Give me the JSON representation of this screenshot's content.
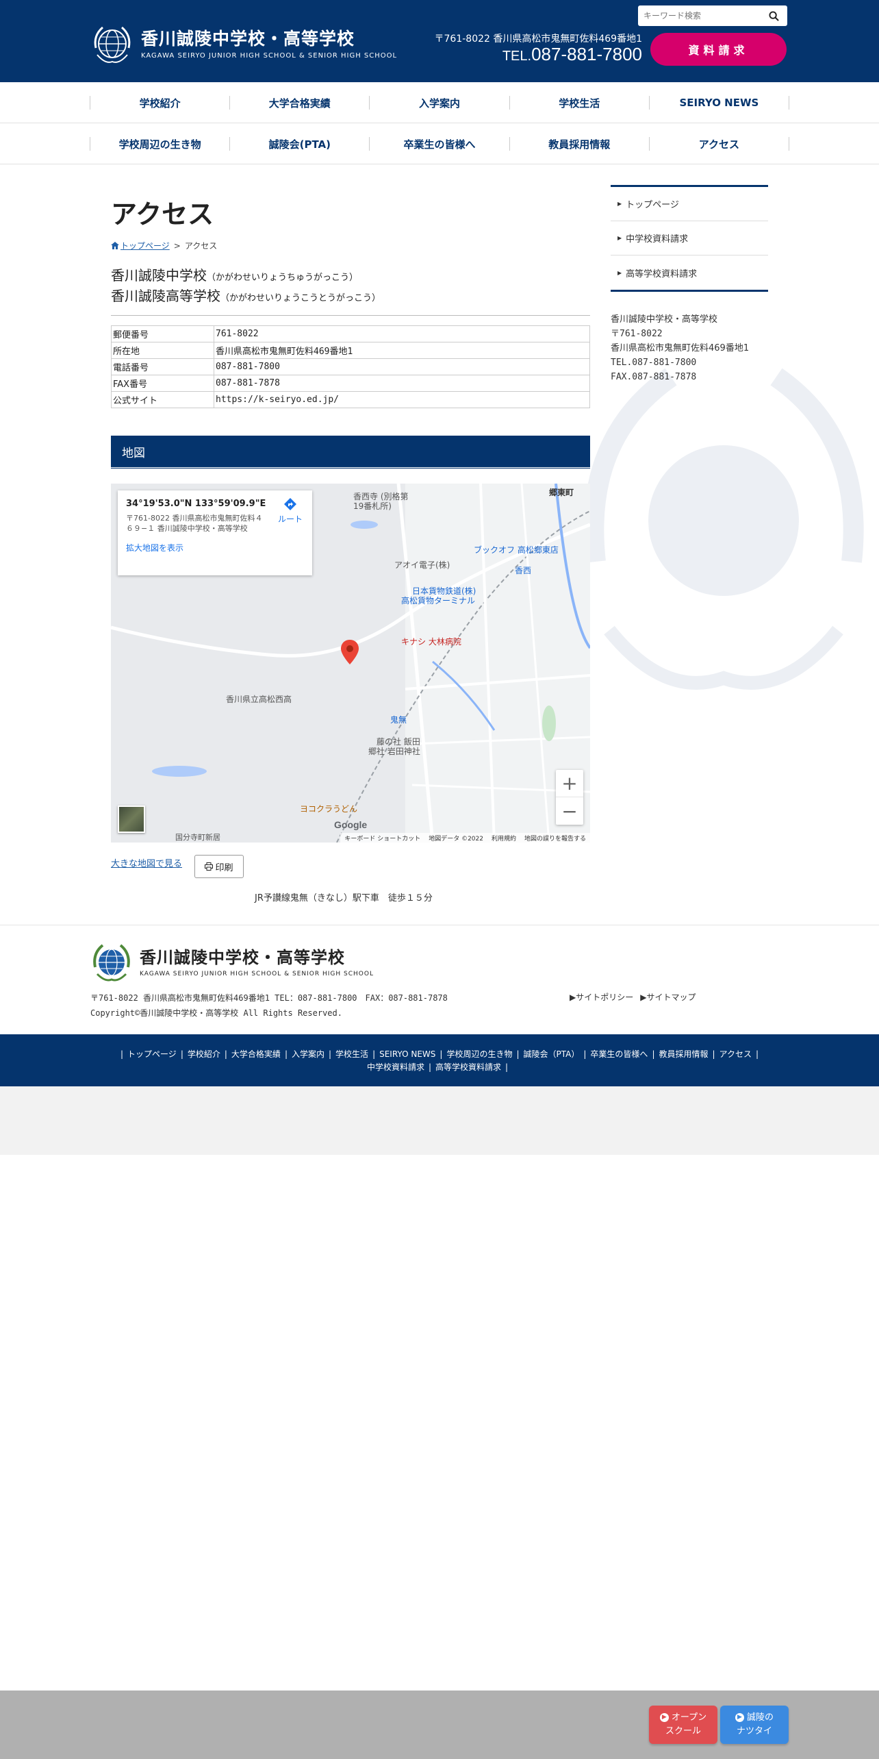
{
  "header": {
    "logo_jp": "香川誠陵中学校・高等学校",
    "logo_en": "KAGAWA SEIRYO JUNIOR HIGH SCHOOL & SENIOR HIGH SCHOOL",
    "search_placeholder": "キーワード検索",
    "address": "〒761-8022 香川県高松市鬼無町佐料469番地1",
    "tel_prefix": "TEL.",
    "tel": "087-881-7800",
    "request_button": "資料請求",
    "brand_color": "#05346d",
    "accent_color": "#d6006b"
  },
  "nav": {
    "row1": [
      "学校紹介",
      "大学合格実績",
      "入学案内",
      "学校生活",
      "SEIRYO NEWS"
    ],
    "row2": [
      "学校周辺の生き物",
      "誠陵会(PTA)",
      "卒業生の皆様へ",
      "教員採用情報",
      "アクセス"
    ]
  },
  "main": {
    "title": "アクセス",
    "breadcrumb": {
      "home": "トップページ",
      "separator": ">",
      "current": "アクセス"
    },
    "school_names": [
      {
        "name": "香川誠陵中学校",
        "kana": "（かがわせいりょうちゅうがっこう）"
      },
      {
        "name": "香川誠陵高等学校",
        "kana": "（かがわせいりょうこうとうがっこう）"
      }
    ],
    "info_table": [
      {
        "key": "郵便番号",
        "value": "761-8022"
      },
      {
        "key": "所在地",
        "value": "香川県高松市鬼無町佐料469番地1"
      },
      {
        "key": "電話番号",
        "value": "087-881-7800"
      },
      {
        "key": "FAX番号",
        "value": "087-881-7878"
      },
      {
        "key": "公式サイト",
        "value": "https://k-seiryo.ed.jp/"
      }
    ],
    "map_heading": "地図",
    "map": {
      "coord": "34°19'53.0\"N 133°59'09.9\"E",
      "address": "〒761-8022 香川県高松市鬼無町佐料４６９−１ 香川誠陵中学校・高等学校",
      "route": "ルート",
      "enlarge": "拡大地図を表示",
      "labels": {
        "kozai": "香西寺 (別格第19番札所)",
        "aoi": "アオイ電子(株)",
        "nippon": "日本貨物鉄道(株)",
        "terminal": "高松貨物ターミナル",
        "bookoff": "ブックオフ 高松郷東店",
        "kinashi_hosp": "キナシ 大林病院",
        "highschool": "香川県立高松西高",
        "kinashi": "鬼無",
        "fujinomori": "藤の社 飯田",
        "iwata": "郷社 岩田神社",
        "udon": "ヨコクラうどん",
        "kokubunji": "国分寺町新居",
        "kozai2": "香西",
        "gotocho": "郷東町"
      },
      "google": "Google",
      "footer": [
        "キーボード ショートカット",
        "地図データ ©2022",
        "利用規約",
        "地図の誤りを報告する"
      ],
      "zoom_in": "+",
      "zoom_out": "−"
    },
    "big_map_link": "大きな地図で見る",
    "print_button": "印刷",
    "station": "JR予讃線鬼無（きなし）駅下車　徒歩１５分"
  },
  "sidebar": {
    "items": [
      "トップページ",
      "中学校資料請求",
      "高等学校資料請求"
    ],
    "info": [
      "香川誠陵中学校・高等学校",
      "〒761-8022",
      "香川県高松市鬼無町佐料469番地1",
      "TEL.087-881-7800",
      "FAX.087-881-7878"
    ]
  },
  "footer": {
    "logo_jp": "香川誠陵中学校・高等学校",
    "logo_en": "KAGAWA SEIRYO JUNIOR HIGH SCHOOL & SENIOR HIGH SCHOOL",
    "address": "〒761-8022 香川県高松市鬼無町佐料469番地1 TEL：087-881-7800　FAX：087-881-7878",
    "copyright": "Copyright©香川誠陵中学校・高等学校 All Rights Reserved.",
    "links": [
      "サイトポリシー",
      "サイトマップ"
    ],
    "nav": [
      "トップページ",
      "学校紹介",
      "大学合格実績",
      "入学案内",
      "学校生活",
      "SEIRYO NEWS",
      "学校周辺の生き物",
      "誠陵会（PTA）",
      "卒業生の皆様へ",
      "教員採用情報",
      "アクセス",
      "中学校資料請求",
      "高等学校資料請求"
    ]
  },
  "floating": {
    "open_school_1": "オープン",
    "open_school_2": "スクール",
    "natsutai_1": "誠陵の",
    "natsutai_2": "ナツタイ"
  }
}
